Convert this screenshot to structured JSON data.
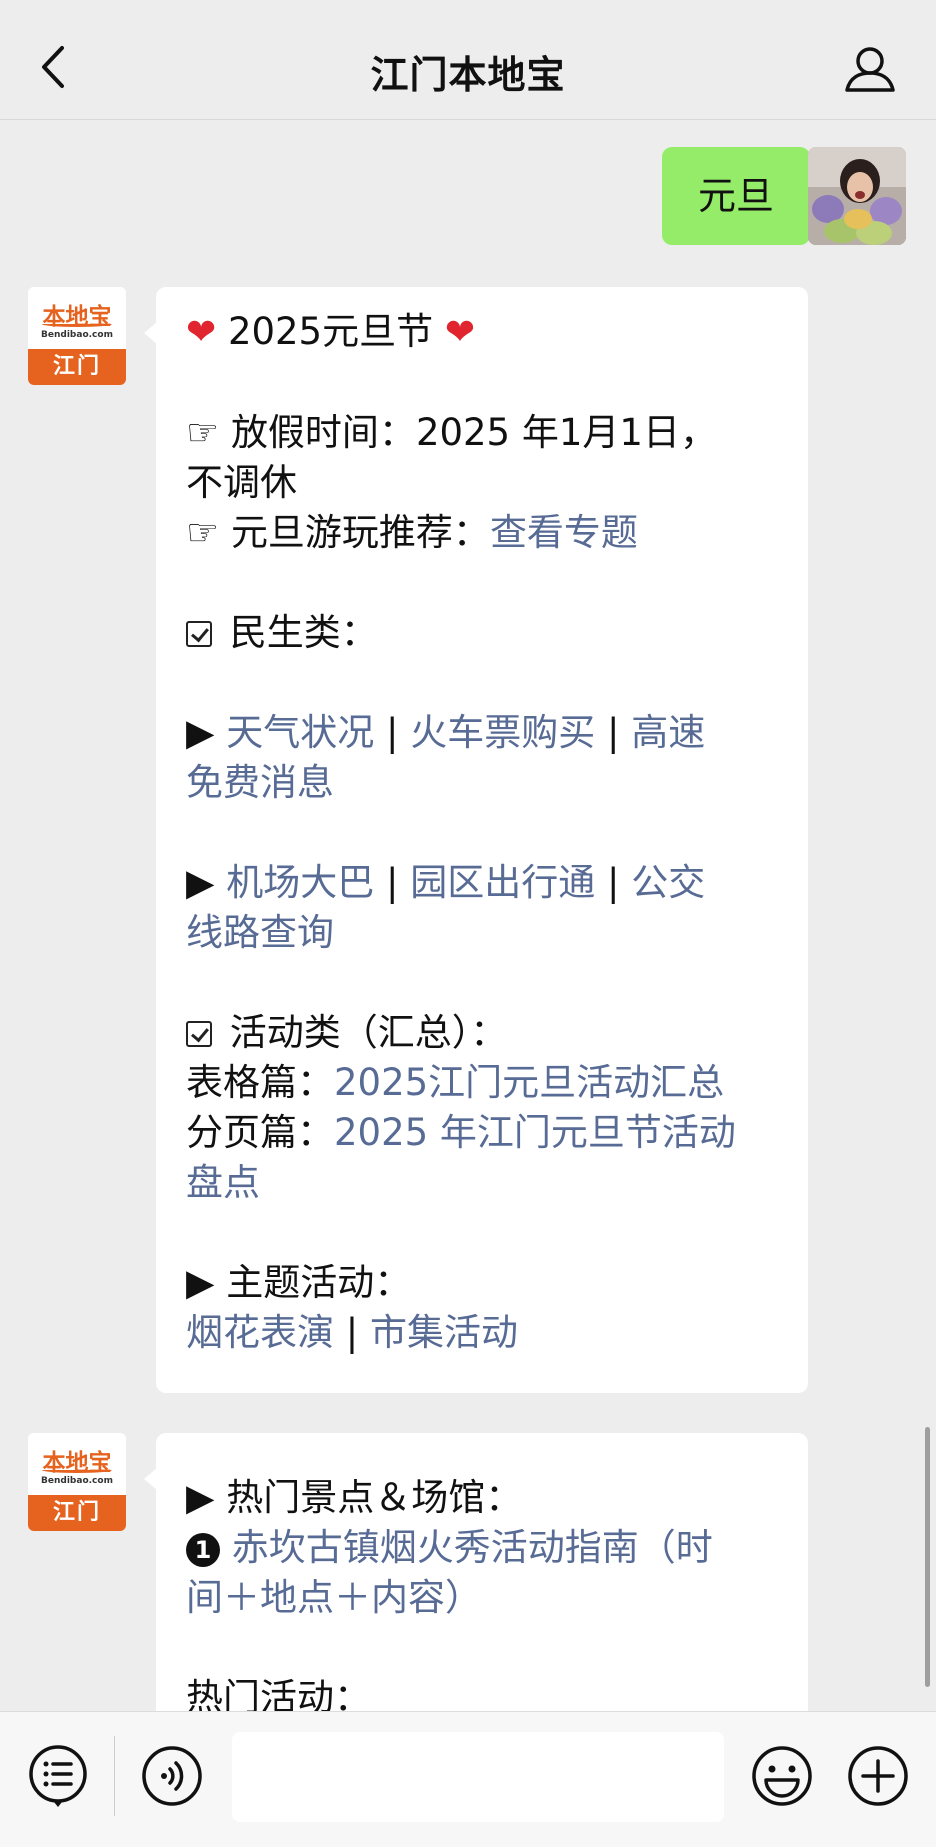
{
  "header": {
    "title": "江门本地宝"
  },
  "user_message": {
    "text": "元旦"
  },
  "bot": {
    "brand": "本地宝",
    "domain": "Bendibao.com",
    "city": "江门"
  },
  "message1": {
    "title": "2025元旦节",
    "holiday_label": "放假时间：",
    "holiday_value": "2025 年1月1日，",
    "holiday_value2": "不调休",
    "recommend_label": "元旦游玩推荐：",
    "recommend_link": "查看专题",
    "livelihood_heading": "民生类：",
    "weather": "天气状况",
    "train": "火车票购买",
    "highway": "高速",
    "highway2": "免费消息",
    "airport": "机场大巴",
    "park": "园区出行通",
    "bus": "公交",
    "bus2": "线路查询",
    "activity_heading": "活动类（汇总）：",
    "table_label": "表格篇：",
    "table_link": "2025江门元旦活动汇总",
    "page_label": "分页篇：",
    "page_link": "2025 年江门元旦节活动",
    "page_link2": "盘点",
    "theme_heading": "主题活动：",
    "fireworks": "烟花表演",
    "market": "市集活动",
    "divider": "|"
  },
  "message2": {
    "spots_heading": "热门景点＆场馆：",
    "item1_num": "1",
    "item1_link": "赤坎古镇烟火秀活动指南（时",
    "item1_link2": "间＋地点＋内容）",
    "hot_activities": "热门活动："
  },
  "input": {
    "placeholder": ""
  },
  "icons": {
    "bullet": "☞",
    "triangle": "▶"
  }
}
